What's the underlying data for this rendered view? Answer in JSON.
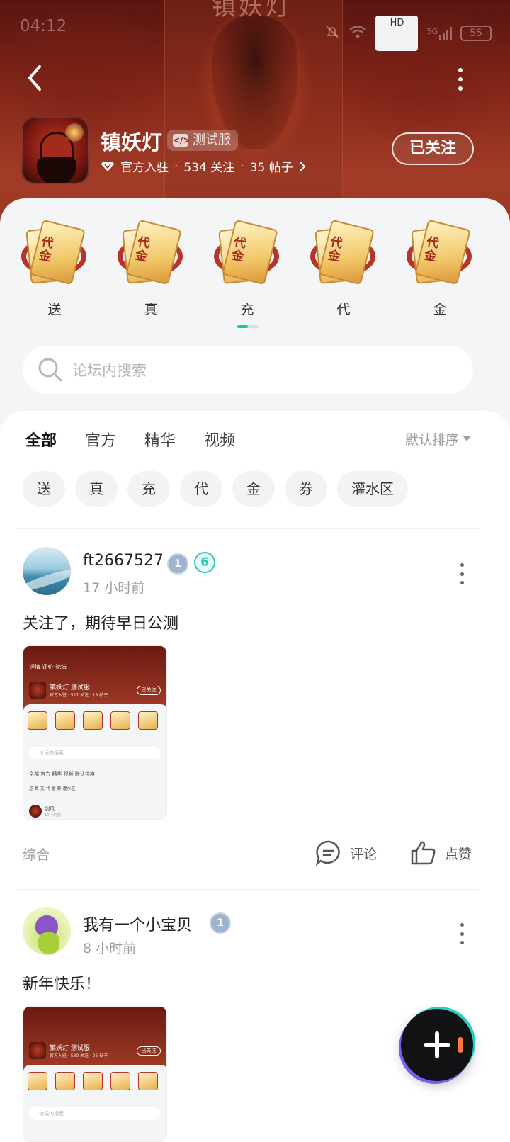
{
  "status_bar": {
    "time": "04:12",
    "network": "HD",
    "signal": "5G",
    "battery": "55"
  },
  "header": {
    "art_title": "镇妖灯",
    "game_name": "镇妖灯",
    "test_badge": "测试服",
    "official": "官方入驻",
    "followers": "534 关注",
    "posts": "35 帖子",
    "follow_button": "已关注"
  },
  "gifts": [
    {
      "label": "送",
      "coupon_text": "代金"
    },
    {
      "label": "真",
      "coupon_text": "代金"
    },
    {
      "label": "充",
      "coupon_text": "代金"
    },
    {
      "label": "代",
      "coupon_text": "代金"
    },
    {
      "label": "金",
      "coupon_text": "代金"
    }
  ],
  "search": {
    "placeholder": "论坛内搜索"
  },
  "tabs": [
    "全部",
    "官方",
    "精华",
    "视频"
  ],
  "active_tab": "全部",
  "sort_label": "默认排序",
  "chips": [
    "送",
    "真",
    "充",
    "代",
    "金",
    "券",
    "灌水区"
  ],
  "posts": [
    {
      "user": "ft2667527",
      "level_badge": "1",
      "extra_badge": "6",
      "time": "17 小时前",
      "text": "关注了，期待早日公测",
      "category": "综合",
      "comment_label": "评论",
      "like_label": "点赞",
      "thumb": {
        "nav": "详情  评价  论坛",
        "name": "镇妖灯 测试服",
        "meta": "官方入驻 · 527 关注 · 18 帖子",
        "follow": "已关注",
        "search": "论坛内搜索",
        "tabs": "全部   官方   精华   视频          默认排序",
        "chips": "送   真   充   代   金   券   灌水区",
        "user": "剑风",
        "user_time": "10 小时前"
      }
    },
    {
      "user": "我有一个小宝贝",
      "level_badge": "1",
      "time": "8 小时前",
      "text": "新年快乐！",
      "thumb": {
        "nav": "",
        "name": "镇妖灯 测试服",
        "meta": "官方入驻 · 530 关注 · 25 帖子",
        "follow": "已关注",
        "search": "论坛内搜索"
      }
    }
  ],
  "colors": {
    "accent": "#1bc6b5",
    "header_red": "#8a2a1c",
    "fab_bg": "#121214"
  }
}
